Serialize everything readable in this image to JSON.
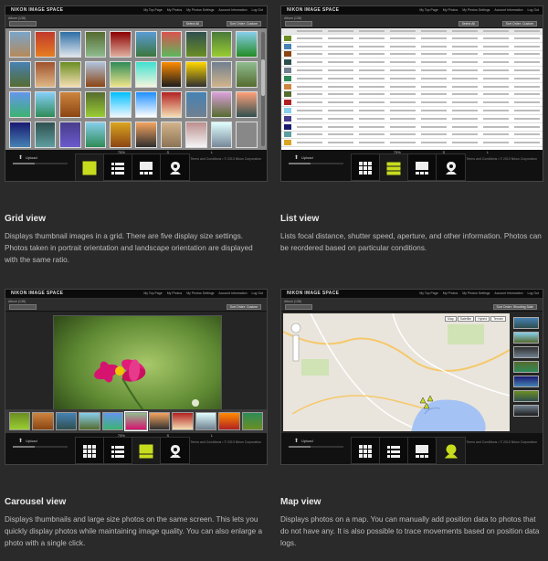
{
  "app": {
    "brand": "NIKON IMAGE SPACE",
    "nav": [
      "My Top Page",
      "My Photos",
      "My Photos Settings",
      "Account Information",
      "Log Out"
    ],
    "album": "Album (138)",
    "select_all": "Select All",
    "sort": "Sort Order: Custom",
    "sort_map": "Sort Order: Shooting Date",
    "upload": "Upload",
    "footer": "Nikon Image Space Policy • Terms and Conditions • © 2013 Nikon Corporation",
    "zoom_labels": [
      "75%",
      "S",
      "L"
    ],
    "upload_progress": 0.4
  },
  "map_types": [
    "Map",
    "Satellite",
    "Hybrid",
    "Terrain"
  ],
  "view_buttons": [
    "grid-view",
    "list-view",
    "carousel-view",
    "map-view"
  ],
  "accent_color": "#c8dc1e",
  "panels": [
    {
      "title": "Grid view",
      "description": "Displays thumbnail images in a grid. There are five display size settings. Photos taken in portrait orientation and landscape orientation are displayed with the same ratio.",
      "active_view": 0
    },
    {
      "title": "List view",
      "description": "Lists focal distance, shutter speed, aperture, and other information. Photos can be reordered based on particular conditions.",
      "active_view": 1
    },
    {
      "title": "Carousel view",
      "description": "Displays thumbnails and large size photos on the same screen. This lets you quickly display photos while maintaining image quality. You can also enlarge a photo with a single click.",
      "active_view": 2
    },
    {
      "title": "Map view",
      "description": "Displays photos on a map. You can manually add position data to photos that do not have any. It is also possible to trace movements based on position data logs.",
      "active_view": 3
    }
  ]
}
